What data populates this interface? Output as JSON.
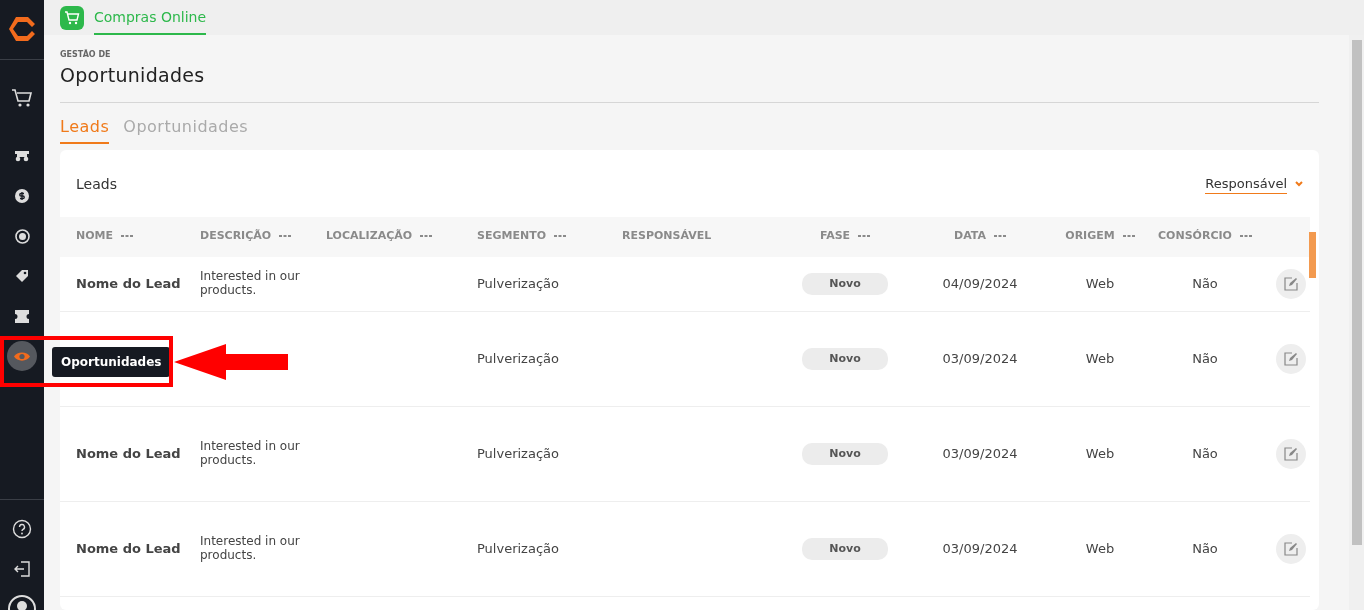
{
  "topbar": {
    "tabs": [
      {
        "label": "Compras Online",
        "selected": true
      }
    ]
  },
  "sidebar": {
    "items": [
      {
        "kind": "cart",
        "selected": false
      },
      {
        "kind": "tractor",
        "selected": false
      },
      {
        "kind": "dollar",
        "selected": false
      },
      {
        "kind": "coin",
        "selected": false
      },
      {
        "kind": "tag",
        "selected": false
      },
      {
        "kind": "ticket",
        "selected": false
      },
      {
        "kind": "eye",
        "selected": true
      }
    ],
    "bottom": [
      {
        "kind": "help"
      },
      {
        "kind": "logout"
      },
      {
        "kind": "user"
      }
    ]
  },
  "tooltip": "Oportunidades",
  "header": {
    "eyebrow": "GESTÃO DE",
    "title": "Oportunidades"
  },
  "tabs": [
    {
      "label": "Leads",
      "selected": true
    },
    {
      "label": "Oportunidades",
      "selected": false
    }
  ],
  "card": {
    "title": "Leads",
    "filter": "Responsável"
  },
  "table": {
    "columns": [
      {
        "label": "NOME",
        "menu": true
      },
      {
        "label": "DESCRIÇÃO",
        "menu": true
      },
      {
        "label": "LOCALIZAÇÃO",
        "menu": true
      },
      {
        "label": "SEGMENTO",
        "menu": true
      },
      {
        "label": "RESPONSÁVEL",
        "menu": false
      },
      {
        "label": "FASE",
        "menu": true
      },
      {
        "label": "DATA",
        "menu": true
      },
      {
        "label": "ORIGEM",
        "menu": true
      },
      {
        "label": "CONSÓRCIO",
        "menu": true
      }
    ],
    "rows": [
      {
        "name": "Nome do Lead",
        "description": "Interested in our products.",
        "segment": "Pulverização",
        "phase": "Novo",
        "date": "04/09/2024",
        "origin": "Web",
        "consorcio": "Não"
      },
      {
        "segment": "Pulverização",
        "phase": "Novo",
        "date": "03/09/2024",
        "origin": "Web",
        "consorcio": "Não"
      },
      {
        "name": "Nome do Lead",
        "description": "Interested in our products.",
        "segment": "Pulverização",
        "phase": "Novo",
        "date": "03/09/2024",
        "origin": "Web",
        "consorcio": "Não"
      },
      {
        "name": "Nome do Lead",
        "description": "Interested in our products.",
        "segment": "Pulverização",
        "phase": "Novo",
        "date": "03/09/2024",
        "origin": "Web",
        "consorcio": "Não"
      }
    ]
  }
}
